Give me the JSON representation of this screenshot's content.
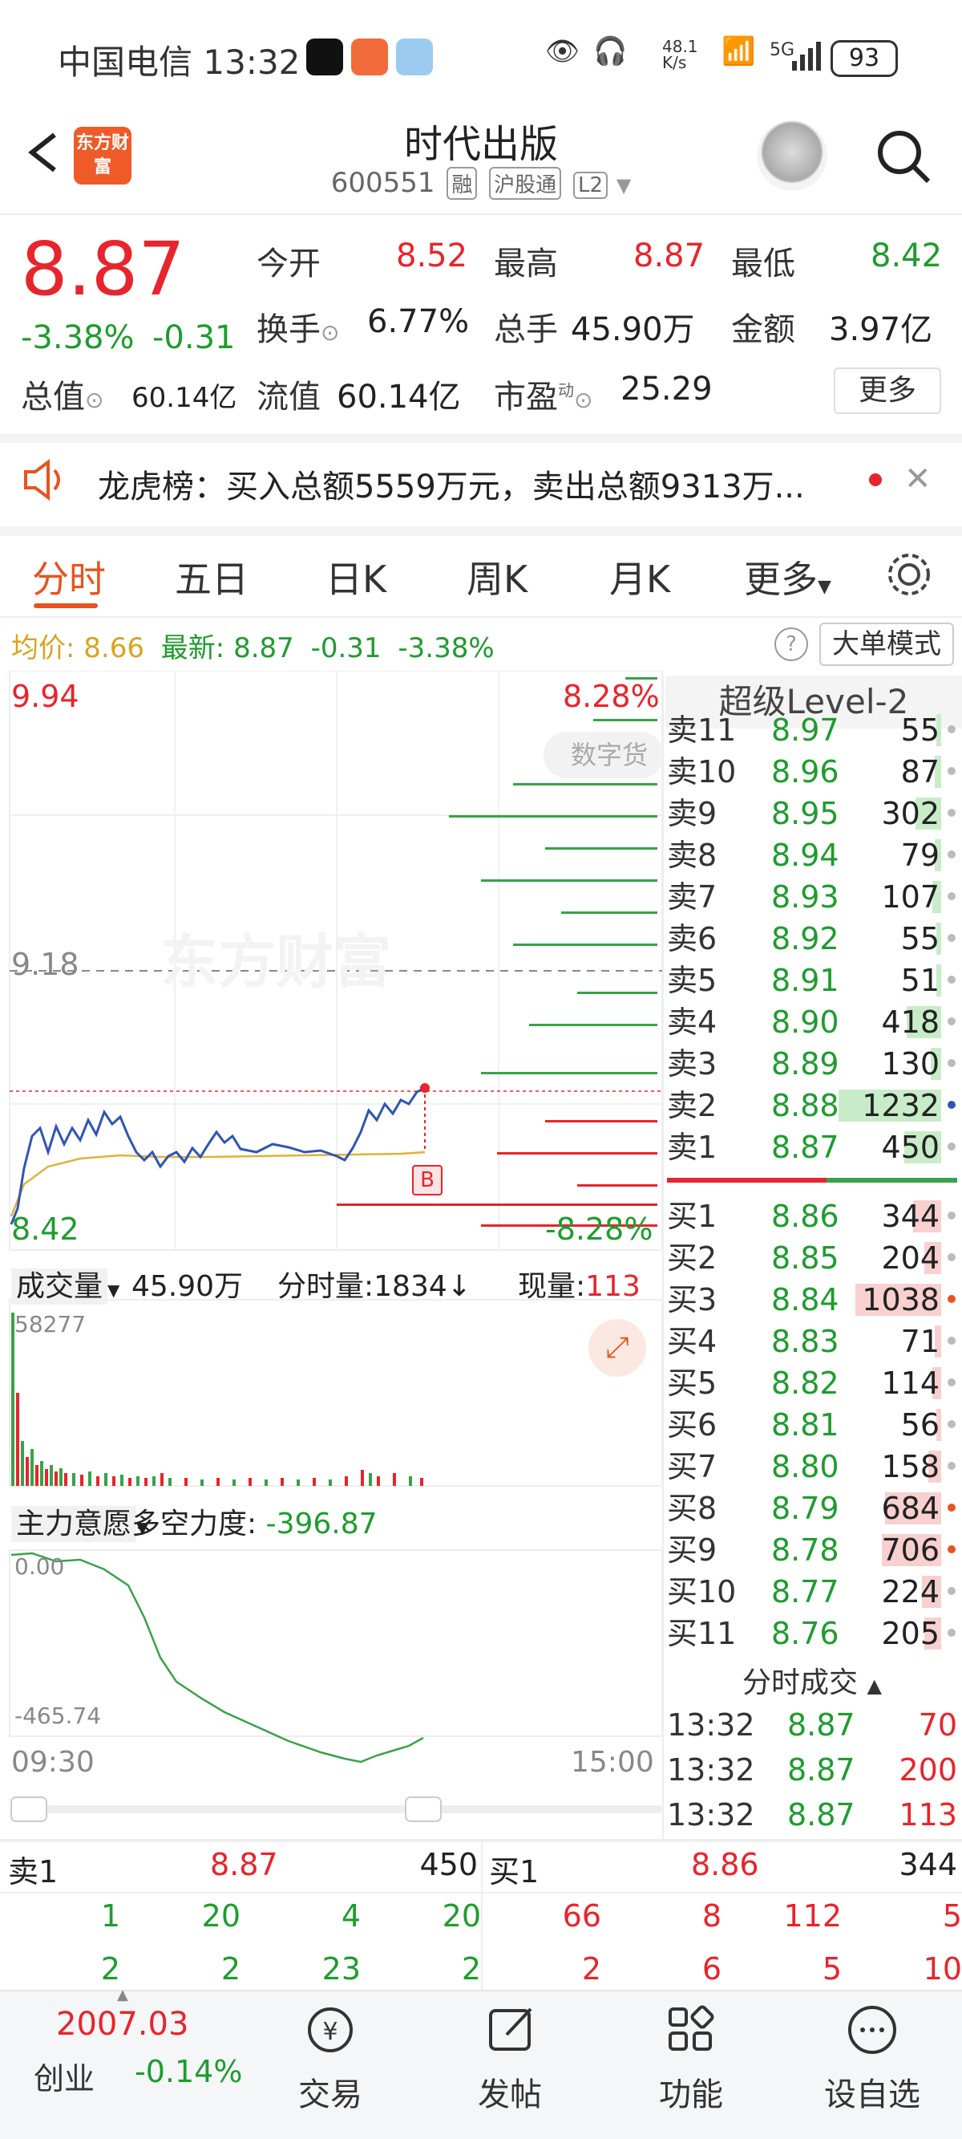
{
  "status_bar": {
    "carrier_time": "中国电信 13:32",
    "net_speed": "48.1\nK/s",
    "network": "5G",
    "battery": "93"
  },
  "header": {
    "logo_text": "东方财富",
    "title": "时代出版",
    "code": "600551",
    "tags": [
      "融",
      "沪股通",
      "L2"
    ]
  },
  "quote": {
    "price": "8.87",
    "change_pct": "-3.38%",
    "change": "-0.31",
    "stats": [
      {
        "label": "今开",
        "value": "8.52"
      },
      {
        "label": "最高",
        "value": "8.87"
      },
      {
        "label": "最低",
        "value": "8.42"
      },
      {
        "label": "换手",
        "value": "6.77%"
      },
      {
        "label": "总手",
        "value": "45.90万"
      },
      {
        "label": "金额",
        "value": "3.97亿"
      },
      {
        "label": "总值",
        "value": "60.14亿"
      },
      {
        "label": "流值",
        "value": "60.14亿"
      },
      {
        "label": "市盈",
        "value": "25.29"
      }
    ],
    "pe_superscript": "动",
    "more_label": "更多"
  },
  "notice": {
    "text": "龙虎榜：买入总额5559万元，卖出总额9313万..."
  },
  "tabs": [
    "分时",
    "五日",
    "日K",
    "周K",
    "月K",
    "更多"
  ],
  "info_line": {
    "avg_label": "均价:",
    "avg": "8.66",
    "latest_label": "最新:",
    "latest": "8.87",
    "chg": "-0.31",
    "pct": "-3.38%"
  },
  "big_order_label": "大单模式",
  "chart_labels": {
    "top_price": "9.94",
    "top_pct": "8.28%",
    "mid_price": "9.18",
    "low_price": "8.42",
    "low_pct": "-8.28%",
    "watermark": "东方财富",
    "digital_tag": "数字货",
    "b_marker": "B"
  },
  "volume_bar": {
    "selector": "成交量",
    "total": "45.90万",
    "minute_label": "分时量:1834",
    "now_label": "现量:",
    "now_value": "113",
    "max": "58277"
  },
  "force_bar": {
    "selector": "主力意愿",
    "label": "多空力度:",
    "value": "-396.87",
    "top": "0.00",
    "bottom": "-465.74"
  },
  "time_axis": {
    "start": "09:30",
    "end": "15:00"
  },
  "orderbook": {
    "title": "超级Level-2",
    "asks": [
      {
        "label": "卖11",
        "price": "8.97",
        "vol": "55",
        "bar": 0.03
      },
      {
        "label": "卖10",
        "price": "8.96",
        "vol": "87",
        "bar": 0.05
      },
      {
        "label": "卖9",
        "price": "8.95",
        "vol": "302",
        "bar": 0.2
      },
      {
        "label": "卖8",
        "price": "8.94",
        "vol": "79",
        "bar": 0.05
      },
      {
        "label": "卖7",
        "price": "8.93",
        "vol": "107",
        "bar": 0.07
      },
      {
        "label": "卖6",
        "price": "8.92",
        "vol": "55",
        "bar": 0.03
      },
      {
        "label": "卖5",
        "price": "8.91",
        "vol": "51",
        "bar": 0.03
      },
      {
        "label": "卖4",
        "price": "8.90",
        "vol": "418",
        "bar": 0.27
      },
      {
        "label": "卖3",
        "price": "8.89",
        "vol": "130",
        "bar": 0.08
      },
      {
        "label": "卖2",
        "price": "8.88",
        "vol": "1232",
        "bar": 0.8
      },
      {
        "label": "卖1",
        "price": "8.87",
        "vol": "450",
        "bar": 0.29
      }
    ],
    "bids": [
      {
        "label": "买1",
        "price": "8.86",
        "vol": "344",
        "bar": 0.22
      },
      {
        "label": "买2",
        "price": "8.85",
        "vol": "204",
        "bar": 0.13
      },
      {
        "label": "买3",
        "price": "8.84",
        "vol": "1038",
        "bar": 0.67
      },
      {
        "label": "买4",
        "price": "8.83",
        "vol": "71",
        "bar": 0.05
      },
      {
        "label": "买5",
        "price": "8.82",
        "vol": "114",
        "bar": 0.07
      },
      {
        "label": "买6",
        "price": "8.81",
        "vol": "56",
        "bar": 0.04
      },
      {
        "label": "买7",
        "price": "8.80",
        "vol": "158",
        "bar": 0.1
      },
      {
        "label": "买8",
        "price": "8.79",
        "vol": "684",
        "bar": 0.44
      },
      {
        "label": "买9",
        "price": "8.78",
        "vol": "706",
        "bar": 0.46
      },
      {
        "label": "买10",
        "price": "8.77",
        "vol": "224",
        "bar": 0.15
      },
      {
        "label": "买11",
        "price": "8.76",
        "vol": "205",
        "bar": 0.13
      }
    ],
    "ticks_title": "分时成交",
    "ticks": [
      {
        "time": "13:32",
        "price": "8.87",
        "vol": "70"
      },
      {
        "time": "13:32",
        "price": "8.87",
        "vol": "200"
      },
      {
        "time": "13:32",
        "price": "8.87",
        "vol": "113"
      }
    ]
  },
  "bottom_queue": {
    "sell": {
      "label": "卖1",
      "price": "8.87",
      "vol": "450",
      "row1": [
        "1",
        "20",
        "4",
        "20"
      ],
      "row2": [
        "2",
        "2",
        "23",
        "2"
      ]
    },
    "buy": {
      "label": "买1",
      "price": "8.86",
      "vol": "344",
      "row1": [
        "66",
        "8",
        "112",
        "5"
      ],
      "row2": [
        "2",
        "6",
        "5",
        "10"
      ]
    }
  },
  "nav": {
    "index_value": "2007.03",
    "index_name": "创业",
    "index_pct": "-0.14%",
    "items": [
      "交易",
      "发帖",
      "功能",
      "设自选"
    ]
  },
  "colors": {
    "up": "#e8242c",
    "down": "#1e9c2e",
    "accent": "#e8531f",
    "avg": "#e0b23a"
  }
}
